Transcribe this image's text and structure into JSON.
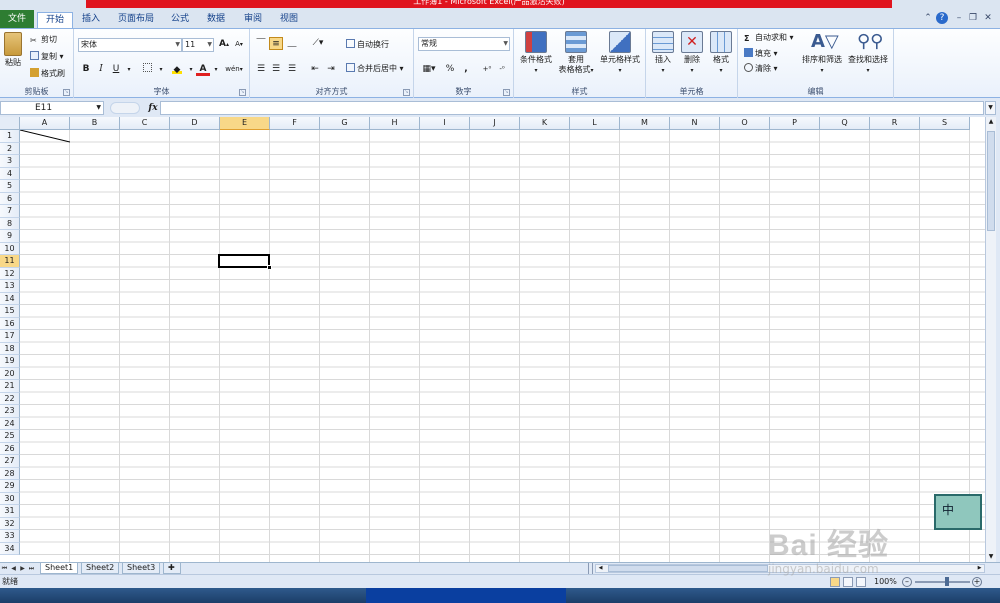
{
  "title_text": "工作簿1 - Microsoft Excel(产品激活失败)",
  "ribbon_tabs": [
    {
      "label": "文件"
    },
    {
      "label": "开始"
    },
    {
      "label": "插入"
    },
    {
      "label": "页面布局"
    },
    {
      "label": "公式"
    },
    {
      "label": "数据"
    },
    {
      "label": "审阅"
    },
    {
      "label": "视图"
    }
  ],
  "clipboard": {
    "paste": "粘贴",
    "cut": "剪切",
    "copy": "复制",
    "format_painter": "格式刷",
    "group_label": "剪贴板"
  },
  "font": {
    "name": "宋体",
    "size": "11",
    "bold": "B",
    "italic": "I",
    "underline": "U",
    "group_label": "字体",
    "grow": "A",
    "shrink": "A",
    "font_color_letter": "A",
    "phonetic": "wén"
  },
  "alignment": {
    "wrap_text": "自动换行",
    "merge_center": "合并后居中",
    "group_label": "对齐方式"
  },
  "number": {
    "format": "常规",
    "percent": "%",
    "comma": ",",
    "group_label": "数字"
  },
  "styles": {
    "conditional": "条件格式",
    "table_line1": "套用",
    "table_line2": "表格格式",
    "cell_styles": "单元格样式",
    "group_label": "样式"
  },
  "cells": {
    "insert": "插入",
    "delete": "删除",
    "format": "格式",
    "group_label": "单元格"
  },
  "editing": {
    "autosum": "自动求和",
    "fill": "填充",
    "clear": "清除",
    "sort_filter": "排序和筛选",
    "find_select": "查找和选择",
    "group_label": "编辑"
  },
  "formula_bar": {
    "name_box": "E11",
    "fx": "fx",
    "formula": ""
  },
  "columns": [
    "A",
    "B",
    "C",
    "D",
    "E",
    "F",
    "G",
    "H",
    "I",
    "J",
    "K",
    "L",
    "M",
    "N",
    "O",
    "P",
    "Q",
    "R",
    "S"
  ],
  "selected_column": "E",
  "rows": [
    "1",
    "2",
    "3",
    "4",
    "5",
    "6",
    "7",
    "8",
    "9",
    "10",
    "11",
    "12",
    "13",
    "14",
    "15",
    "16",
    "17",
    "18",
    "19",
    "20",
    "21",
    "22",
    "23",
    "24",
    "25",
    "26",
    "27",
    "28",
    "29",
    "30",
    "31",
    "32",
    "33",
    "34"
  ],
  "selected_row": "11",
  "sheet_tabs": [
    {
      "label": "Sheet1",
      "active": true
    },
    {
      "label": "Sheet2",
      "active": false
    },
    {
      "label": "Sheet3",
      "active": false
    }
  ],
  "status": {
    "ready": "就绪",
    "zoom": "100%"
  },
  "ime": {
    "label": "中"
  },
  "watermark": {
    "brand": "Bai 经验",
    "url": "jingyan.baidu.com"
  },
  "colors": {
    "file_tab": "#2e7d32",
    "title_red": "#e0141e",
    "selection_header": "#f8d888"
  }
}
